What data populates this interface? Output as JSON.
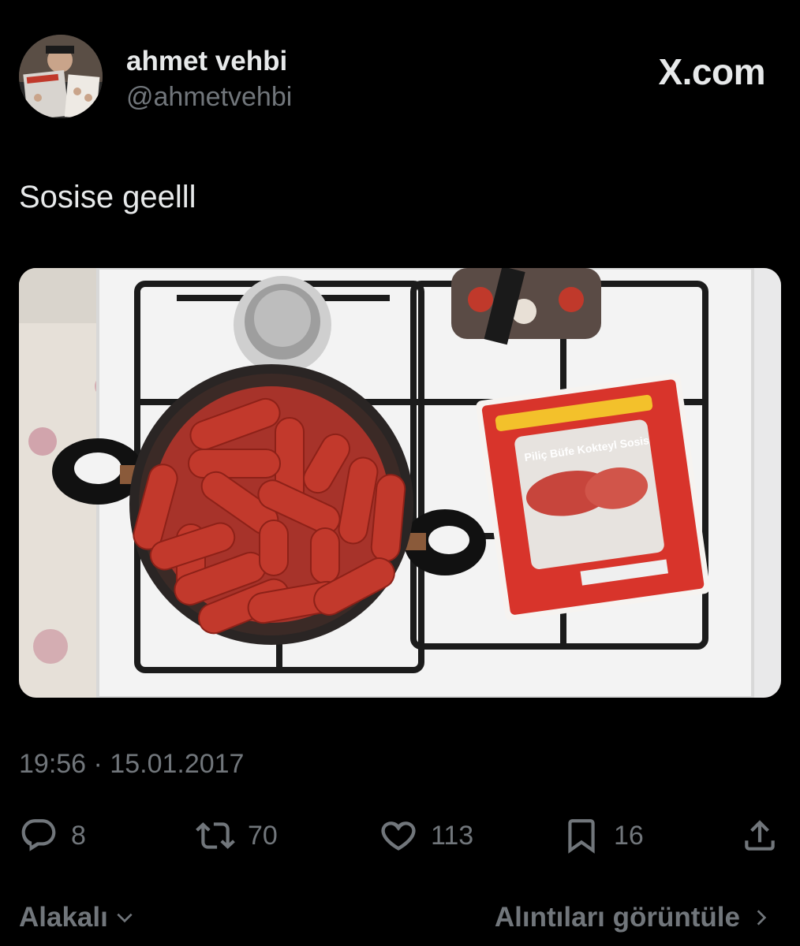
{
  "author": {
    "display_name": "ahmet vehbi",
    "handle": "@ahmetvehbi"
  },
  "brand": {
    "label": "X.com"
  },
  "tweet": {
    "text": "Sosise geelll",
    "timestamp": "19:56 · 15.01.2017"
  },
  "media": {
    "package_label": "Piliç Büfe Kokteyl Sosis"
  },
  "actions": {
    "replies": "8",
    "retweets": "70",
    "likes": "113",
    "bookmarks": "16"
  },
  "footer": {
    "sort_label": "Alakalı",
    "quotes_label": "Alıntıları görüntüle"
  },
  "icons": [
    "reply-icon",
    "retweet-icon",
    "like-icon",
    "bookmark-icon",
    "share-icon",
    "chevron-down-icon",
    "chevron-right-icon"
  ]
}
